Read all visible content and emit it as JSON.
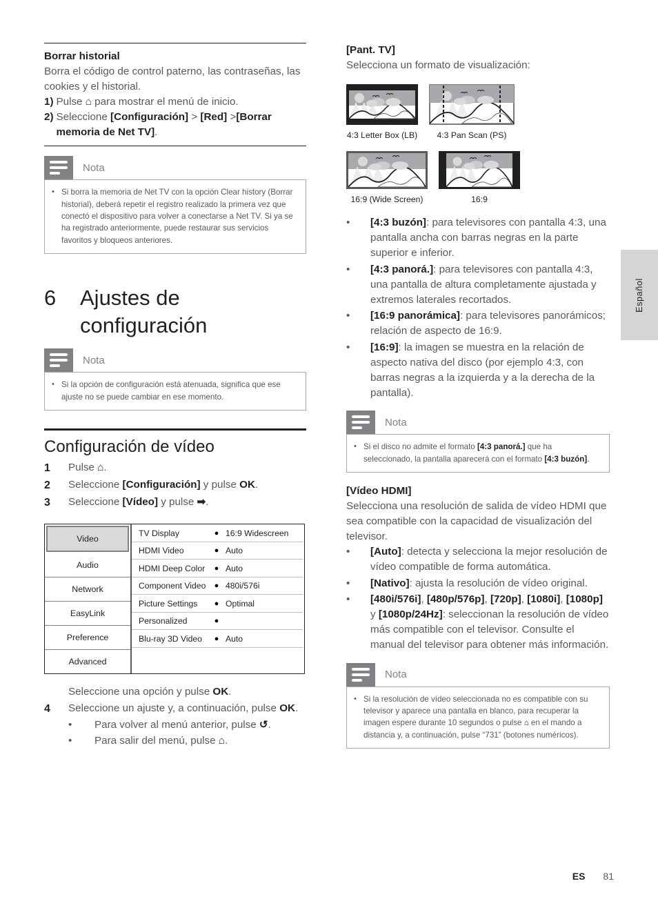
{
  "page": {
    "language_tab": "Español",
    "footer_locale": "ES",
    "footer_page_number": "81"
  },
  "left_column": {
    "clear_history": {
      "heading": "Borrar historial",
      "intro": "Borra el código de control paterno, las contraseñas, las cookies y el historial.",
      "steps": [
        {
          "marker": "1)",
          "text_pre": "Pulse ",
          "icon": "home-icon",
          "text_post": " para mostrar el menú de inicio."
        },
        {
          "marker": "2)",
          "text_pre": "Seleccione ",
          "bold1": "[Configuración]",
          "sep1": " > ",
          "bold2": "[Red]",
          "sep2": " >",
          "bold3": "[Borrar memoria de Net TV]",
          "text_post": "."
        }
      ]
    },
    "note_1": {
      "title": "Nota",
      "icon": "note-icon",
      "items": [
        "Si borra la memoria de Net TV con la opción Clear history (Borrar historial), deberá repetir el registro realizado la primera vez que conectó el dispositivo para volver a conectarse a Net TV. Si ya se ha registrado anteriormente, puede restaurar sus servicios favoritos y bloqueos anteriores."
      ]
    },
    "chapter": {
      "number": "6",
      "title": "Ajustes de configuración"
    },
    "note_2": {
      "title": "Nota",
      "icon": "note-icon",
      "items": [
        "Si la opción de configuración está atenuada, significa que ese ajuste no se puede cambiar en ese momento."
      ]
    },
    "video_config": {
      "heading": "Configuración de vídeo",
      "steps": [
        {
          "num": "1",
          "pre": "Pulse ",
          "icon": "home-icon",
          "post": "."
        },
        {
          "num": "2",
          "pre": "Seleccione ",
          "bold1": "[Configuración]",
          "mid": " y pulse ",
          "bold2": "OK",
          "post": "."
        },
        {
          "num": "3",
          "pre": "Seleccione ",
          "bold1": "[Vídeo]",
          "mid": " y pulse ",
          "icon": "left-arrow-icon",
          "post": "."
        }
      ],
      "after_menu_text_pre": "Seleccione una opción y pulse ",
      "after_menu_bold": "OK",
      "after_menu_text_post": ".",
      "step4": {
        "num": "4",
        "pre": "Seleccione un ajuste y, a continuación, pulse ",
        "bold": "OK",
        "post": "."
      },
      "substeps": [
        {
          "pre": "Para volver al menú anterior, pulse ",
          "icon": "return-arrow-icon",
          "post": "."
        },
        {
          "pre": "Para salir del menú, pulse ",
          "icon": "home-icon",
          "post": "."
        }
      ]
    },
    "menu_screenshot": {
      "sidebar": [
        {
          "label": "Video",
          "selected": true
        },
        {
          "label": "Audio",
          "selected": false
        },
        {
          "label": "Network",
          "selected": false
        },
        {
          "label": "EasyLink",
          "selected": false
        },
        {
          "label": "Preference",
          "selected": false
        },
        {
          "label": "Advanced",
          "selected": false
        }
      ],
      "rows": [
        {
          "label": "TV Display",
          "bullet": "●",
          "value": "16:9 Widescreen"
        },
        {
          "label": "HDMI Video",
          "bullet": "●",
          "value": "Auto"
        },
        {
          "label": "HDMI Deep Color",
          "bullet": "●",
          "value": "Auto"
        },
        {
          "label": "Component Video",
          "bullet": "●",
          "value": "480i/576i"
        },
        {
          "label": "Picture Settings",
          "bullet": "●",
          "value": "Optimal"
        },
        {
          "label": "Personalized",
          "bullet": "●",
          "value": ""
        },
        {
          "label": "Blu-ray 3D Video",
          "bullet": "●",
          "value": "Auto"
        }
      ]
    }
  },
  "right_column": {
    "tv_display": {
      "heading": "[Pant. TV]",
      "intro": "Selecciona un formato de visualización:",
      "figures": [
        {
          "caption": "4:3 Letter Box (LB)",
          "type": "letterbox"
        },
        {
          "caption": "4:3 Pan Scan (PS)",
          "type": "panscan"
        },
        {
          "caption": "16:9 (Wide Screen)",
          "type": "widescreen"
        },
        {
          "caption": "16:9",
          "type": "pillarbox"
        }
      ],
      "bullets": [
        {
          "bold": "[4:3 buzón]",
          "text": ": para televisores con pantalla 4:3, una pantalla ancha con barras negras en la parte superior e inferior."
        },
        {
          "bold": "[4:3 panorá.]",
          "text": ": para televisores con pantalla 4:3, una pantalla de altura completamente ajustada y extremos laterales recortados."
        },
        {
          "bold": "[16:9 panorámica]",
          "text": ": para televisores panorámicos; relación de aspecto de 16:9."
        },
        {
          "bold": "[16:9]",
          "text": ": la imagen se muestra en la relación de aspecto nativa del disco (por ejemplo 4:3, con barras negras a la izquierda y a la derecha de la pantalla)."
        }
      ]
    },
    "note_3": {
      "title": "Nota",
      "icon": "note-icon",
      "item_parts": {
        "p1": "Si el disco no admite el formato ",
        "b1": "[4:3 panorá.]",
        "p2": " que ha seleccionado, la pantalla aparecerá con el formato ",
        "b2": "[4:3 buzón]",
        "p3": "."
      }
    },
    "hdmi_video": {
      "heading": "[Vídeo HDMI]",
      "intro": "Selecciona una resolución de salida de vídeo HDMI que sea compatible con la capacidad de visualización del televisor.",
      "bullets": [
        {
          "bold": "[Auto]",
          "text": ": detecta y selecciona la mejor resolución de vídeo compatible de forma automática."
        },
        {
          "bold": "[Nativo]",
          "text": ": ajusta la resolución de vídeo original."
        },
        {
          "bold": "[480i/576i]",
          "text2": ", ",
          "bold2": "[480p/576p]",
          "text3": ", ",
          "bold3": "[720p]",
          "text4": ", ",
          "bold4": "[1080i]",
          "text5": ", ",
          "bold5": "[1080p]",
          "text6": " y ",
          "bold6": "[1080p/24Hz]",
          "text": ": seleccionan la resolución de vídeo más compatible con el televisor. Consulte el manual del televisor para obtener más información."
        }
      ]
    },
    "note_4": {
      "title": "Nota",
      "icon": "note-icon",
      "item_parts": {
        "p1": "Si la resolución de vídeo seleccionada no es compatible con su televisor y aparece una pantalla en blanco, para recuperar la imagen espere durante 10 segundos o pulse ",
        "icon": "home-icon",
        "p2": " en el mando a distancia y, a continuación, pulse “731” (botones numéricos)."
      }
    }
  }
}
